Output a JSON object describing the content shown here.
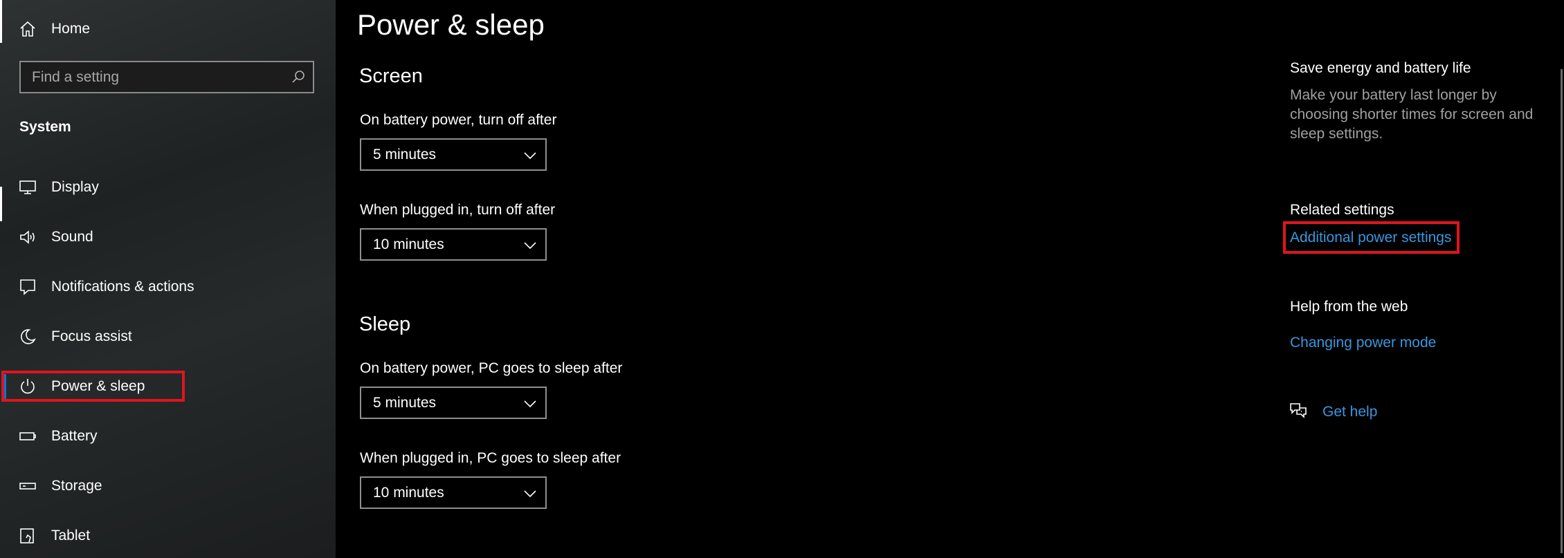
{
  "sidebar": {
    "home_label": "Home",
    "search_placeholder": "Find a setting",
    "section_title": "System",
    "items": [
      {
        "label": "Display",
        "icon": "display-icon"
      },
      {
        "label": "Sound",
        "icon": "speaker-icon"
      },
      {
        "label": "Notifications & actions",
        "icon": "notification-icon"
      },
      {
        "label": "Focus assist",
        "icon": "moon-icon"
      },
      {
        "label": "Power & sleep",
        "icon": "power-icon",
        "selected": true
      },
      {
        "label": "Battery",
        "icon": "battery-icon"
      },
      {
        "label": "Storage",
        "icon": "storage-icon"
      },
      {
        "label": "Tablet",
        "icon": "tablet-icon"
      }
    ]
  },
  "main": {
    "title": "Power & sleep",
    "screen": {
      "heading": "Screen",
      "battery_label": "On battery power, turn off after",
      "battery_value": "5 minutes",
      "plugged_label": "When plugged in, turn off after",
      "plugged_value": "10 minutes"
    },
    "sleep": {
      "heading": "Sleep",
      "battery_label": "On battery power, PC goes to sleep after",
      "battery_value": "5 minutes",
      "plugged_label": "When plugged in, PC goes to sleep after",
      "plugged_value": "10 minutes"
    }
  },
  "right_panel": {
    "save_energy_heading": "Save energy and battery life",
    "save_energy_desc": "Make your battery last longer by choosing shorter times for screen and sleep settings.",
    "related_heading": "Related settings",
    "additional_power_link": "Additional power settings",
    "help_heading": "Help from the web",
    "changing_power_link": "Changing power mode",
    "get_help_link": "Get help"
  },
  "colors": {
    "accent": "#0078d7",
    "link": "#3a96dd",
    "annotation_red": "#e0141e",
    "background": "#000000"
  }
}
